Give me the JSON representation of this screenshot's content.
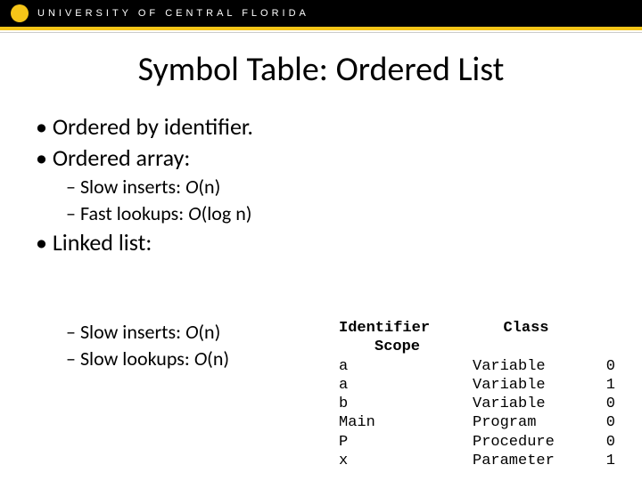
{
  "header": {
    "university": "UNIVERSITY OF CENTRAL FLORIDA"
  },
  "title": "Symbol Table: Ordered List",
  "bullets": {
    "b1": "Ordered by identifier.",
    "b2": "Ordered array:",
    "b2a_pre": "Slow inserts: ",
    "b2a_o": "O",
    "b2a_post": "(n)",
    "b2b_pre": "Fast lookups: ",
    "b2b_o": "O",
    "b2b_post": "(log n)",
    "b3": "Linked list:",
    "b3a_pre": "Slow inserts: ",
    "b3a_o": "O",
    "b3a_post": "(n)",
    "b3b_pre": "Slow lookups: ",
    "b3b_o": "O",
    "b3b_post": "(n)"
  },
  "table": {
    "headers": {
      "identifier": "Identifier",
      "class": "Class",
      "scope": "Scope"
    },
    "rows": [
      {
        "id": "a",
        "class": "Variable",
        "scope": "0"
      },
      {
        "id": "a",
        "class": "Variable",
        "scope": "1"
      },
      {
        "id": "b",
        "class": "Variable",
        "scope": "0"
      },
      {
        "id": "Main",
        "class": "Program",
        "scope": "0"
      },
      {
        "id": "P",
        "class": "Procedure",
        "scope": "0"
      },
      {
        "id": "x",
        "class": "Parameter",
        "scope": "1"
      }
    ]
  }
}
